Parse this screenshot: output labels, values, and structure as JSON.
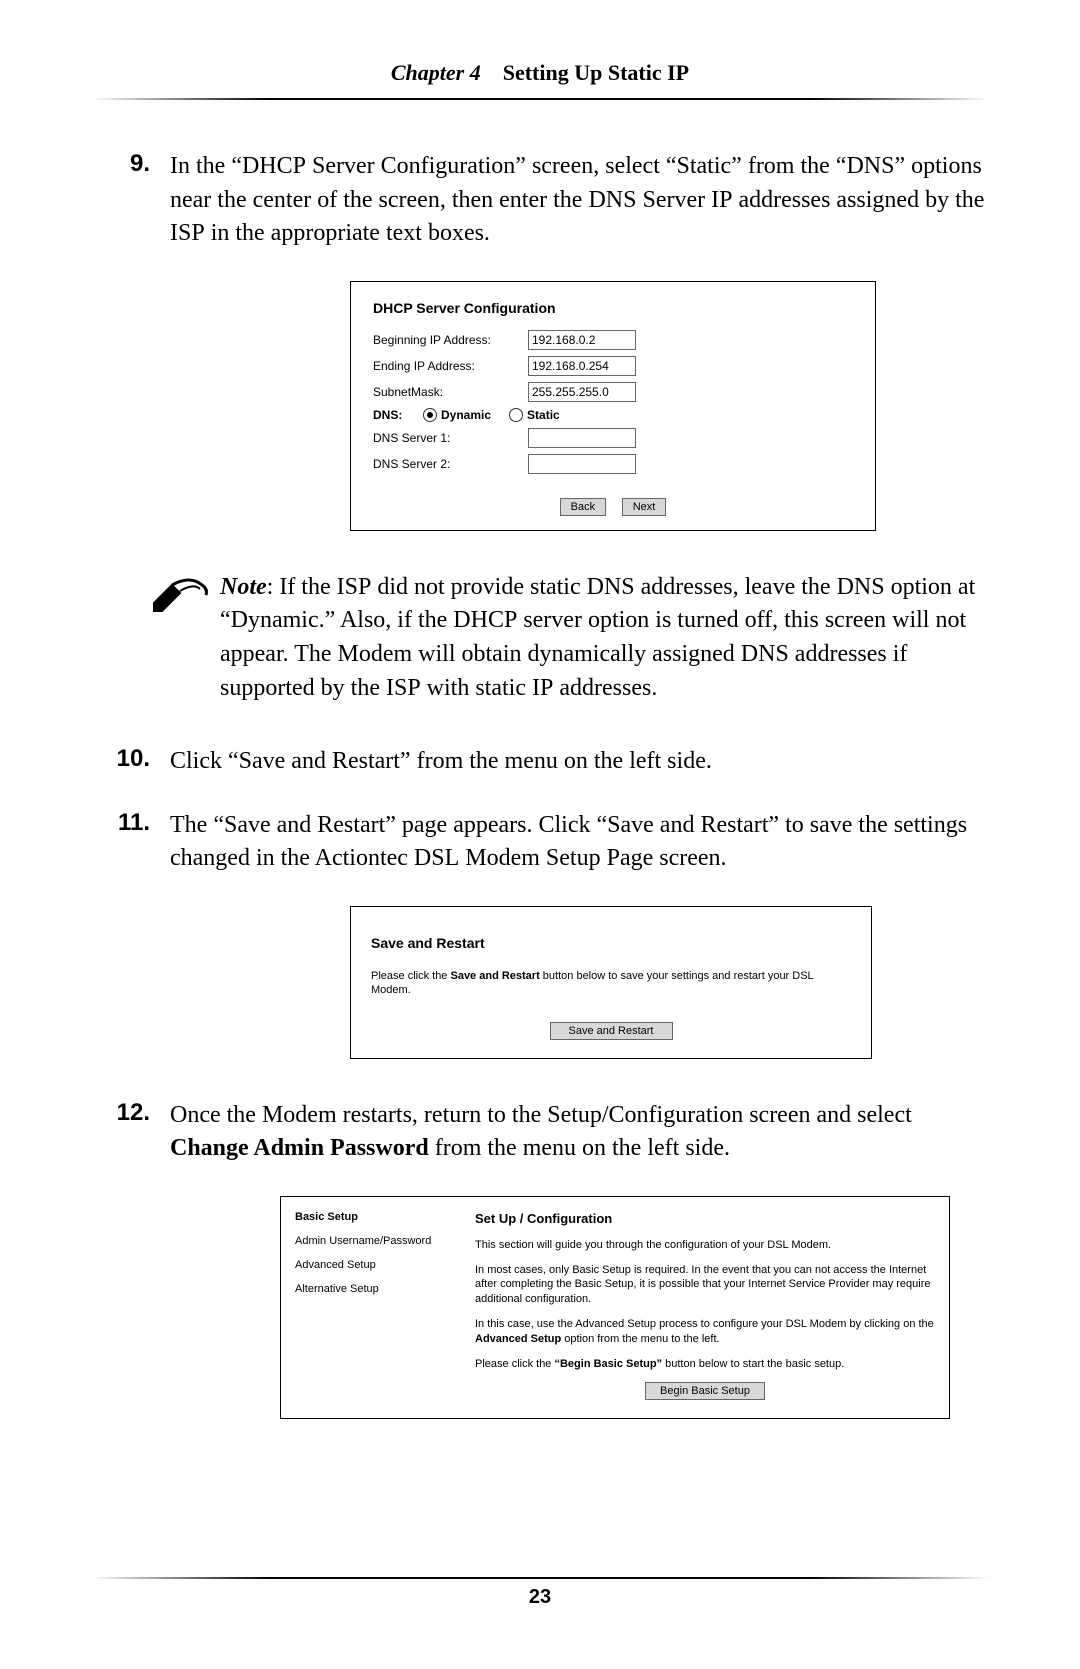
{
  "header": {
    "chapter_label": "Chapter 4",
    "chapter_title": "Setting Up Static IP"
  },
  "steps": {
    "s9": {
      "num": "9.",
      "body_pre": "In the “",
      "body_dhcp": "DHCP",
      "body_mid1": " Server Configuration” screen, select “Static” from the “",
      "body_dns": "DNS",
      "body_mid2": "” options near the center of the screen, then enter the ",
      "body_dns2": "DNS",
      "body_mid3": " Server ",
      "body_ip": "IP",
      "body_end": " addresses assigned by the ",
      "body_isp": "ISP",
      "body_tail": " in the appropriate text boxes."
    },
    "s10": {
      "num": "10.",
      "body": "Click “Save and Restart” from the menu on the left side."
    },
    "s11": {
      "num": "11.",
      "body_a": "The “Save and Restart” page appears. Click “Save and Restart” to save the settings changed in the Actiontec ",
      "body_dsl": "DSL",
      "body_b": " Modem Setup Page screen."
    },
    "s12": {
      "num": "12.",
      "body_a": "Once the Modem restarts, return to the Setup/Configuration screen and select ",
      "body_bold": "Change Admin Password",
      "body_b": " from the menu on the left side."
    }
  },
  "note": {
    "label": "Note",
    "pre": ": If the ",
    "isp1": "ISP",
    "t1": " did not provide static ",
    "dns1": "DNS",
    "t2": " addresses, leave the ",
    "dns2": "DNS",
    "t3": " option at “Dynamic.” Also, if the ",
    "dhcp": "DHCP",
    "t4": " server option is turned off, this screen will not appear. The Modem will obtain dynamically assigned ",
    "dns3": "DNS",
    "t5": " addresses if supported by the ",
    "isp2": "ISP",
    "t6": " with static ",
    "ip": "IP",
    "t7": " addresses."
  },
  "fig_dhcp": {
    "title": "DHCP Server Configuration",
    "rows": {
      "begin_label": "Beginning IP Address:",
      "begin_value": "192.168.0.2",
      "end_label": "Ending IP Address:",
      "end_value": "192.168.0.254",
      "subnet_label": "SubnetMask:",
      "subnet_value": "255.255.255.0",
      "dns_label": "DNS:",
      "dynamic": "Dynamic",
      "static": "Static",
      "dns1_label": "DNS Server 1:",
      "dns1_value": "",
      "dns2_label": "DNS Server 2:",
      "dns2_value": ""
    },
    "back": "Back",
    "next": "Next"
  },
  "fig_save": {
    "title": "Save and Restart",
    "para_a": "Please click the ",
    "para_bold": "Save and Restart",
    "para_b": " button below to save your settings and restart your DSL Modem.",
    "button": "Save and Restart"
  },
  "fig_config": {
    "menu": {
      "basic": "Basic Setup",
      "admin": "Admin Username/Password",
      "advanced": "Advanced Setup",
      "alternative": "Alternative Setup"
    },
    "title": "Set Up / Configuration",
    "p1": "This section will guide you through the configuration of your DSL Modem.",
    "p2": "In most cases, only Basic Setup is required. In the event that you can not access the Internet after completing the Basic Setup, it is possible that your Internet Service Provider may require additional configuration.",
    "p3_a": "In this case, use the Advanced Setup process to configure your DSL Modem by clicking on the ",
    "p3_bold": "Advanced Setup",
    "p3_b": " option from the menu to the left.",
    "p4_a": "Please click the ",
    "p4_bold": "“Begin Basic Setup”",
    "p4_b": " button below to start the basic setup.",
    "button": "Begin Basic Setup"
  },
  "page_number": "23"
}
